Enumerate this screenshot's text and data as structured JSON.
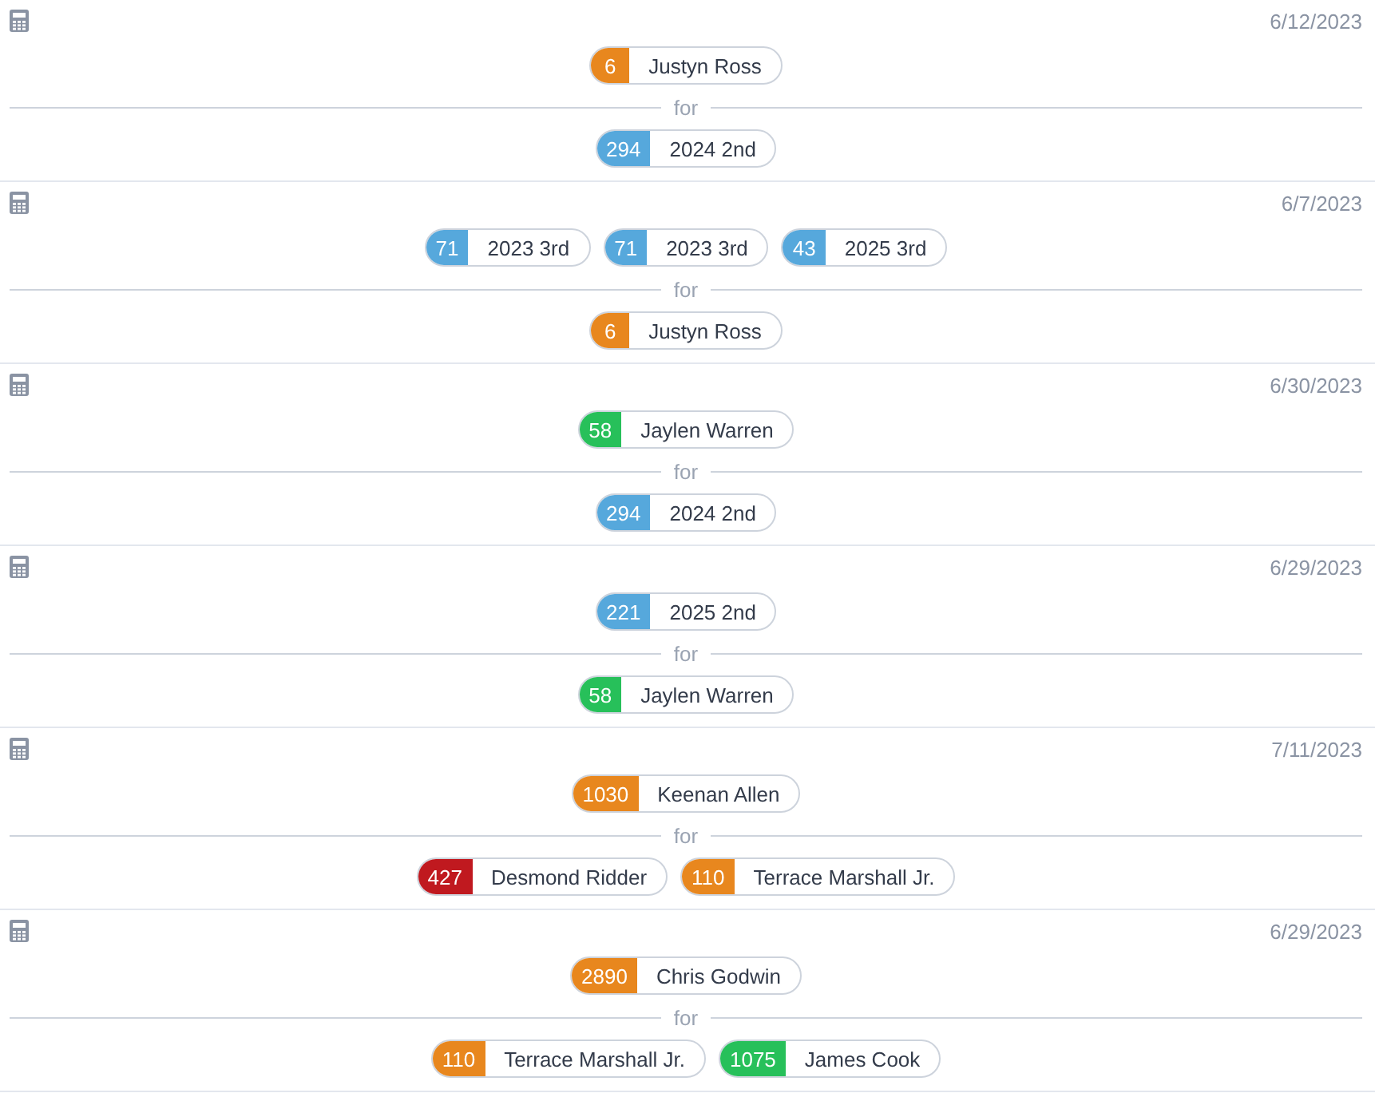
{
  "trades": [
    {
      "date": "6/12/2023",
      "sent": [
        {
          "value": "6",
          "name": "Justyn Ross",
          "color": "#e8871e"
        }
      ],
      "divider": "for",
      "received": [
        {
          "value": "294",
          "name": "2024 2nd",
          "color": "#56a8dc"
        }
      ]
    },
    {
      "date": "6/7/2023",
      "sent": [
        {
          "value": "71",
          "name": "2023 3rd",
          "color": "#56a8dc"
        },
        {
          "value": "71",
          "name": "2023 3rd",
          "color": "#56a8dc"
        },
        {
          "value": "43",
          "name": "2025 3rd",
          "color": "#56a8dc"
        }
      ],
      "divider": "for",
      "received": [
        {
          "value": "6",
          "name": "Justyn Ross",
          "color": "#e8871e"
        }
      ]
    },
    {
      "date": "6/30/2023",
      "sent": [
        {
          "value": "58",
          "name": "Jaylen Warren",
          "color": "#27c05a"
        }
      ],
      "divider": "for",
      "received": [
        {
          "value": "294",
          "name": "2024 2nd",
          "color": "#56a8dc"
        }
      ]
    },
    {
      "date": "6/29/2023",
      "sent": [
        {
          "value": "221",
          "name": "2025 2nd",
          "color": "#56a8dc"
        }
      ],
      "divider": "for",
      "received": [
        {
          "value": "58",
          "name": "Jaylen Warren",
          "color": "#27c05a"
        }
      ]
    },
    {
      "date": "7/11/2023",
      "sent": [
        {
          "value": "1030",
          "name": "Keenan Allen",
          "color": "#e8871e"
        }
      ],
      "divider": "for",
      "received": [
        {
          "value": "427",
          "name": "Desmond Ridder",
          "color": "#c0191f"
        },
        {
          "value": "110",
          "name": "Terrace Marshall Jr.",
          "color": "#e8871e"
        }
      ]
    },
    {
      "date": "6/29/2023",
      "sent": [
        {
          "value": "2890",
          "name": "Chris Godwin",
          "color": "#e8871e"
        }
      ],
      "divider": "for",
      "received": [
        {
          "value": "110",
          "name": "Terrace Marshall Jr.",
          "color": "#e8871e"
        },
        {
          "value": "1075",
          "name": "James Cook",
          "color": "#27c05a"
        }
      ]
    }
  ]
}
